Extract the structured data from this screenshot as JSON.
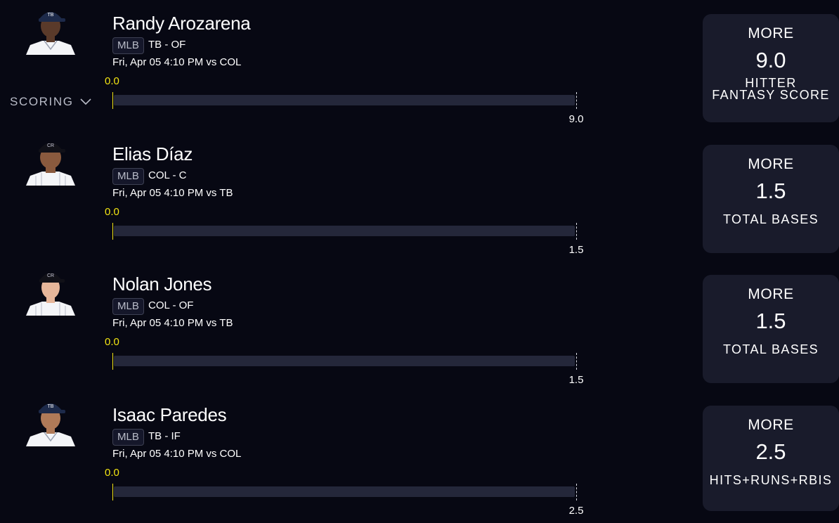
{
  "scoring": {
    "label": "SCORING",
    "icon": "chevron-down-icon"
  },
  "colors": {
    "background": "#070813",
    "card": "#191b2b",
    "accent": "#f3e512",
    "track": "#24273a"
  },
  "picks": [
    {
      "name": "Randy Arozarena",
      "league": "MLB",
      "team_pos": "TB - OF",
      "game": "Fri, Apr 05 4:10 PM  vs COL",
      "current": "0.0",
      "target": "9.0",
      "progress": 0,
      "cap_color": "#1d2a4a",
      "cap_logo": "TB",
      "jersey": "#f4f5f8",
      "skin": "#5a3a2a",
      "card": {
        "direction": "MORE",
        "line": "9.0",
        "stat": "HITTER\nFANTASY SCORE"
      }
    },
    {
      "name": "Elias Díaz",
      "league": "MLB",
      "team_pos": "COL - C",
      "game": "Fri, Apr 05 4:10 PM  vs TB",
      "current": "0.0",
      "target": "1.5",
      "progress": 0,
      "cap_color": "#111118",
      "cap_logo": "CR",
      "jersey": "#f4f5f8",
      "skin": "#8a5a3e",
      "card": {
        "direction": "MORE",
        "line": "1.5",
        "stat": "TOTAL BASES"
      }
    },
    {
      "name": "Nolan Jones",
      "league": "MLB",
      "team_pos": "COL - OF",
      "game": "Fri, Apr 05 4:10 PM  vs TB",
      "current": "0.0",
      "target": "1.5",
      "progress": 0,
      "cap_color": "#111118",
      "cap_logo": "CR",
      "jersey": "#f4f5f8",
      "skin": "#e6b69a",
      "card": {
        "direction": "MORE",
        "line": "1.5",
        "stat": "TOTAL BASES"
      }
    },
    {
      "name": "Isaac Paredes",
      "league": "MLB",
      "team_pos": "TB - IF",
      "game": "Fri, Apr 05 4:10 PM  vs COL",
      "current": "0.0",
      "target": "2.5",
      "progress": 0,
      "cap_color": "#1d2a4a",
      "cap_logo": "TB",
      "jersey": "#f4f5f8",
      "skin": "#b07a58",
      "card": {
        "direction": "MORE",
        "line": "2.5",
        "stat": "HITS+RUNS+RBIS"
      }
    }
  ]
}
